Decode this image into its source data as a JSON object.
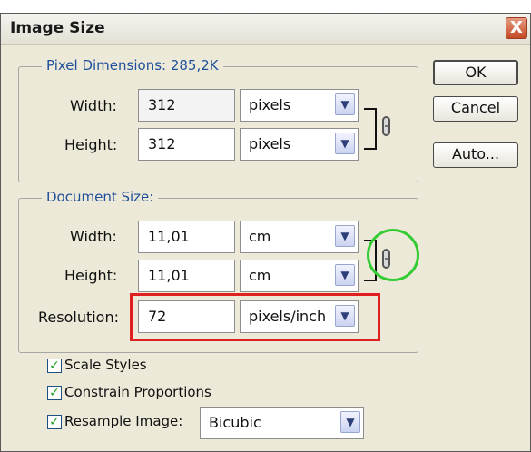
{
  "dialog": {
    "title": "Image Size",
    "close_glyph": "X"
  },
  "pixel_dimensions": {
    "legend": "Pixel Dimensions:  285,2K",
    "width_label": "Width:",
    "width_value": "312",
    "width_unit": "pixels",
    "height_label": "Height:",
    "height_value": "312",
    "height_unit": "pixels"
  },
  "document_size": {
    "legend": "Document Size:",
    "width_label": "Width:",
    "width_value": "11,01",
    "width_unit": "cm",
    "height_label": "Height:",
    "height_value": "11,01",
    "height_unit": "cm",
    "resolution_label": "Resolution:",
    "resolution_value": "72",
    "resolution_unit": "pixels/inch"
  },
  "buttons": {
    "ok": "OK",
    "cancel": "Cancel",
    "auto": "Auto..."
  },
  "options": {
    "scale_styles": "Scale Styles",
    "constrain_proportions": "Constrain Proportions",
    "resample_image": "Resample Image:",
    "resample_method": "Bicubic",
    "scale_styles_checked": true,
    "constrain_checked": true,
    "resample_checked": true
  },
  "icons": {
    "dropdown": "chevron-down-icon",
    "link": "chain-link-icon",
    "check": "checkmark-icon"
  },
  "annotation_colors": {
    "highlight_box": "#e02020",
    "highlight_circle": "#33cc33",
    "legend_text": "#1f4e9a"
  }
}
